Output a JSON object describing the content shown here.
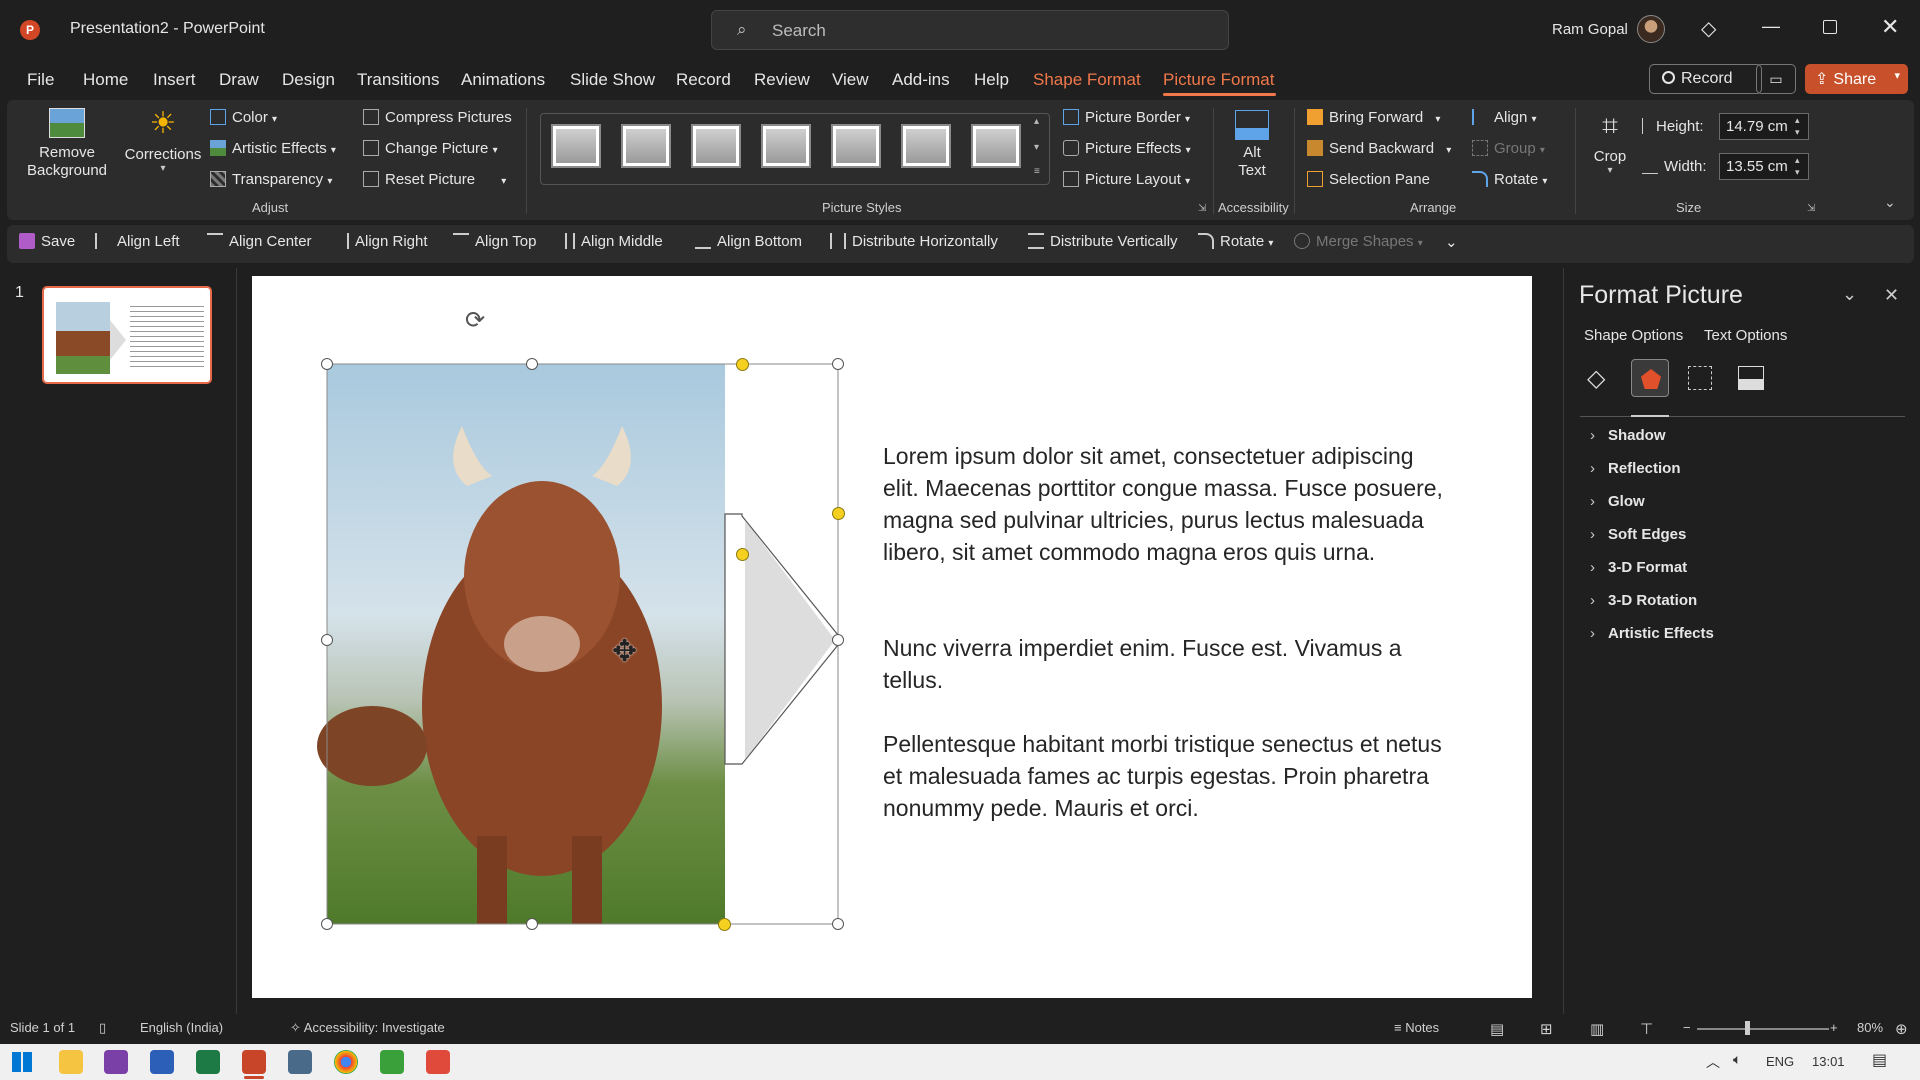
{
  "titlebar": {
    "doc_title": "Presentation2",
    "separator": "-",
    "app_name": "PowerPoint",
    "search_placeholder": "Search",
    "user_name": "Ram Gopal"
  },
  "menu": {
    "items": [
      "File",
      "Home",
      "Insert",
      "Draw",
      "Design",
      "Transitions",
      "Animations",
      "Slide Show",
      "Record",
      "Review",
      "View",
      "Add-ins",
      "Help",
      "Shape Format",
      "Picture Format"
    ],
    "active": "Picture Format",
    "accent_color": "#f0784a",
    "record_button": "Record",
    "share_button": "Share"
  },
  "ribbon": {
    "remove_background": "Remove Background",
    "corrections": "Corrections",
    "color": "Color",
    "artistic_effects": "Artistic Effects",
    "transparency": "Transparency",
    "compress_pictures": "Compress Pictures",
    "change_picture": "Change Picture",
    "reset_picture": "Reset Picture",
    "adjust_group": "Adjust",
    "picture_styles_group": "Picture Styles",
    "picture_border": "Picture Border",
    "picture_effects": "Picture Effects",
    "picture_layout": "Picture Layout",
    "alt_text": "Alt Text",
    "accessibility_group": "Accessibility",
    "bring_forward": "Bring Forward",
    "send_backward": "Send Backward",
    "selection_pane": "Selection Pane",
    "align": "Align",
    "group": "Group",
    "rotate": "Rotate",
    "arrange_group": "Arrange",
    "crop": "Crop",
    "height_label": "Height:",
    "height_value": "14.79 cm",
    "width_label": "Width:",
    "width_value": "13.55 cm",
    "size_group": "Size"
  },
  "qat": {
    "items": [
      "Save",
      "Align Left",
      "Align Center",
      "Align Right",
      "Align Top",
      "Align Middle",
      "Align Bottom",
      "Distribute Horizontally",
      "Distribute Vertically",
      "Rotate",
      "Merge Shapes"
    ]
  },
  "slides": {
    "number": "1"
  },
  "slide": {
    "paragraph1": "Lorem ipsum dolor sit amet, consectetuer adipiscing elit. Maecenas porttitor congue massa. Fusce posuere, magna sed pulvinar ultricies, purus lectus malesuada libero, sit amet commodo magna eros quis urna.",
    "paragraph2": "Nunc viverra imperdiet enim. Fusce est. Vivamus a tellus.",
    "paragraph3": "Pellentesque habitant morbi tristique senectus et netus et malesuada fames ac turpis egestas. Proin pharetra nonummy pede. Mauris et orci."
  },
  "format_pane": {
    "title": "Format Picture",
    "tab_shape": "Shape Options",
    "tab_text": "Text Options",
    "sections": [
      "Shadow",
      "Reflection",
      "Glow",
      "Soft Edges",
      "3-D Format",
      "3-D Rotation",
      "Artistic Effects"
    ]
  },
  "status": {
    "slide_info": "Slide 1 of 1",
    "language": "English (India)",
    "accessibility": "Accessibility: Investigate",
    "notes": "Notes",
    "zoom": "80%"
  },
  "taskbar": {
    "lang": "ENG",
    "time": "13:01"
  }
}
